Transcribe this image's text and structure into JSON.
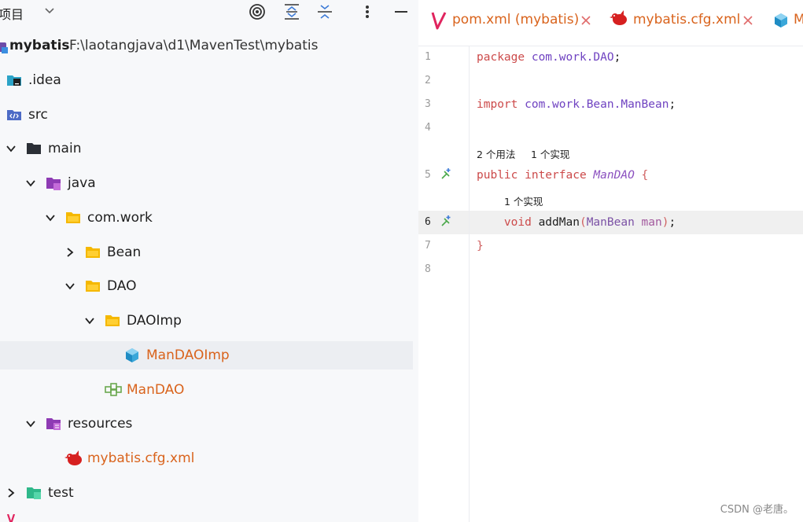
{
  "project_panel": {
    "title": "项目",
    "tree": [
      {
        "label": "mybatis",
        "path": "F:\\laotangjava\\d1\\MavenTest\\mybatis",
        "icon": "module-folder-icon"
      },
      {
        "label": ".idea",
        "icon": "idea-folder-icon"
      },
      {
        "label": "src",
        "icon": "source-folder-icon"
      },
      {
        "label": "main",
        "icon": "folder-dark-icon"
      },
      {
        "label": "java",
        "icon": "java-source-root-icon"
      },
      {
        "label": "com.work",
        "icon": "package-folder-icon"
      },
      {
        "label": "Bean",
        "icon": "package-folder-icon"
      },
      {
        "label": "DAO",
        "icon": "package-folder-icon"
      },
      {
        "label": "DAOImp",
        "icon": "package-folder-icon"
      },
      {
        "label": "ManDAOImp",
        "icon": "class-cube-icon"
      },
      {
        "label": "ManDAO",
        "icon": "interface-icon"
      },
      {
        "label": "resources",
        "icon": "resources-root-icon"
      },
      {
        "label": "mybatis.cfg.xml",
        "icon": "mybatis-bird-icon"
      },
      {
        "label": "test",
        "icon": "test-root-icon"
      }
    ]
  },
  "editor": {
    "tabs": [
      {
        "label": "pom.xml (mybatis)",
        "icon": "maven-icon"
      },
      {
        "label": "mybatis.cfg.xml",
        "icon": "mybatis-bird-icon"
      },
      {
        "label": "M",
        "icon": "class-cube-icon"
      }
    ],
    "line_numbers": [
      "1",
      "2",
      "3",
      "4",
      "5",
      "6",
      "7",
      "8"
    ],
    "code": {
      "l1_kw": "package",
      "l1_rest": " com.work.DAO",
      "l1_semi": ";",
      "l3_kw": "import",
      "l3_rest": " com.work.Bean.ManBean",
      "l3_semi": ";",
      "inlay_usages": "2 个用法",
      "inlay_impls": "1 个实现",
      "l5_kw": "public interface",
      "l5_name": " ManDAO",
      "l5_brace": " {",
      "inlay_impl2": "1 个实现",
      "l6_kw": "    void",
      "l6_method": " addMan",
      "l6_paren_open": "(",
      "l6_type": "ManBean",
      "l6_param": " man",
      "l6_paren_close": ")",
      "l6_semi": ";",
      "l7_brace": "}"
    }
  },
  "watermark": "CSDN @老唐。",
  "colors": {
    "orange": "#d9631c",
    "keyword": "#cc4a4a",
    "panel_bg": "#f7f8fa"
  }
}
